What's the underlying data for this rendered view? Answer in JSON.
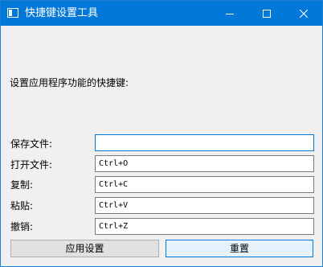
{
  "window": {
    "title": "快捷键设置工具"
  },
  "prompt": "设置应用程序功能的快捷键:",
  "shortcuts": [
    {
      "label": "保存文件:",
      "value": ""
    },
    {
      "label": "打开文件:",
      "value": "Ctrl+O"
    },
    {
      "label": "复制:",
      "value": "Ctrl+C"
    },
    {
      "label": "粘贴:",
      "value": "Ctrl+V"
    },
    {
      "label": "撤销:",
      "value": "Ctrl+Z"
    }
  ],
  "buttons": {
    "apply": "应用设置",
    "reset": "重置"
  },
  "icons": {
    "app": "app-window-icon",
    "minimize": "minimize-icon",
    "maximize": "maximize-icon",
    "close": "close-icon"
  },
  "colors": {
    "titlebar": "#0078d7",
    "background": "#f0f0f0",
    "focus": "#0078d7"
  }
}
